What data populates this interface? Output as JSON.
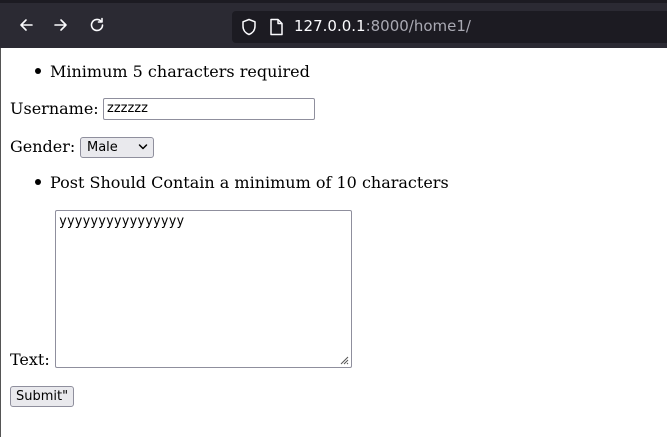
{
  "browser": {
    "url_host": "127.0.0.1",
    "url_rest": ":8000/home1/",
    "icons": [
      "back-arrow-icon",
      "forward-arrow-icon",
      "reload-icon",
      "shield-icon",
      "page-icon"
    ]
  },
  "form": {
    "username_hint": "Minimum 5 characters required",
    "username_label": "Username:",
    "username_value": "zzzzzz",
    "gender_label": "Gender:",
    "gender_selected": "Male",
    "post_hint": "Post Should Contain a minimum of 10 characters",
    "text_label": "Text:",
    "text_value": "yyyyyyyyyyyyyyyy",
    "submit_label": "Submit\""
  }
}
